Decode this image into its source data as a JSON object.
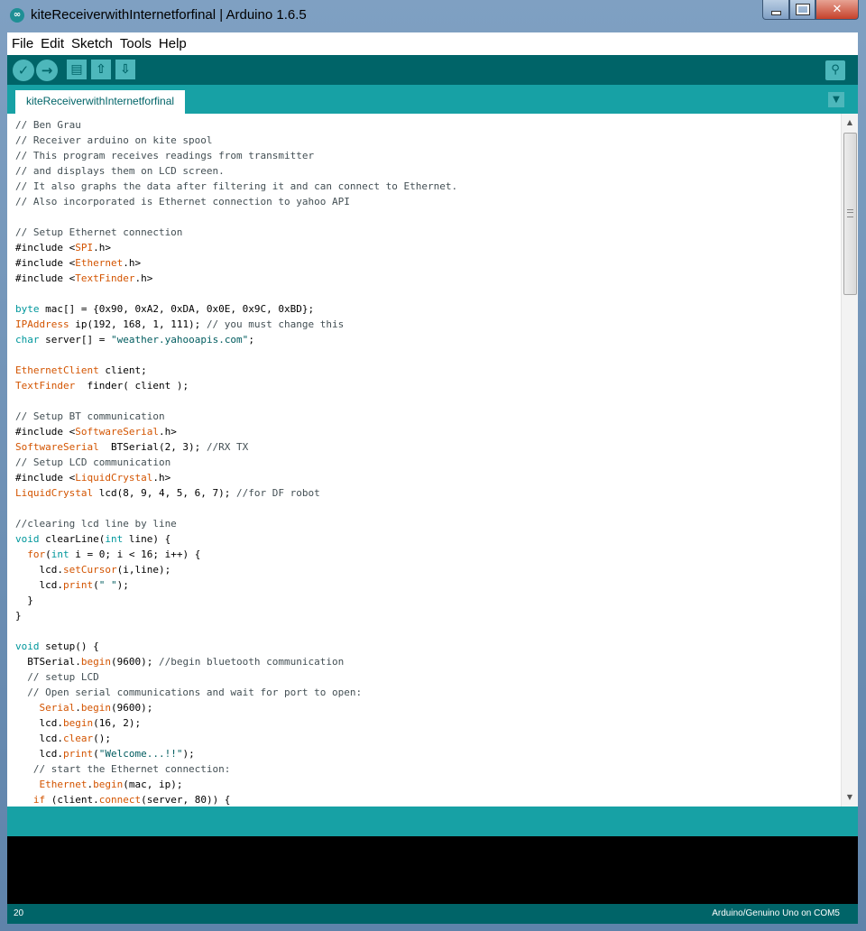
{
  "window": {
    "icon": "arduino-logo-icon",
    "title": "kiteReceiverwithInternetforfinal | Arduino 1.6.5",
    "buttons": {
      "minimize_icon": "minimize-icon",
      "maximize_icon": "maximize-icon",
      "close_icon": "close-icon",
      "close_glyph": "✕"
    }
  },
  "menu": [
    "File",
    "Edit",
    "Sketch",
    "Tools",
    "Help"
  ],
  "toolbar": {
    "verify_icon": "checkmark-icon",
    "upload_icon": "right-arrow-icon",
    "new_icon": "new-file-icon",
    "open_icon": "open-arrow-up-icon",
    "save_icon": "save-arrow-down-icon",
    "serial_monitor_icon": "magnifier-icon",
    "glyphs": {
      "verify": "✓",
      "upload": "→",
      "new": "▤",
      "open": "⇧",
      "save": "⇩",
      "serial": "⚲"
    }
  },
  "tabs": {
    "active": "kiteReceiverwithInternetforfinal",
    "menu_glyph": "▼"
  },
  "code_lines": [
    [
      [
        "c",
        "// Ben Grau"
      ]
    ],
    [
      [
        "c",
        "// Receiver arduino on kite spool"
      ]
    ],
    [
      [
        "c",
        "// This program receives readings from transmitter"
      ]
    ],
    [
      [
        "c",
        "// and displays them on LCD screen."
      ]
    ],
    [
      [
        "c",
        "// It also graphs the data after filtering it and can connect to Ethernet."
      ]
    ],
    [
      [
        "c",
        "// Also incorporated is Ethernet connection to yahoo API"
      ]
    ],
    [],
    [
      [
        "c",
        "// Setup Ethernet connection"
      ]
    ],
    [
      [
        "n",
        "#include <"
      ],
      [
        "t",
        "SPI"
      ],
      [
        "n",
        ".h>"
      ]
    ],
    [
      [
        "n",
        "#include <"
      ],
      [
        "t",
        "Ethernet"
      ],
      [
        "n",
        ".h>"
      ]
    ],
    [
      [
        "n",
        "#include <"
      ],
      [
        "t",
        "TextFinder"
      ],
      [
        "n",
        ".h>"
      ]
    ],
    [],
    [
      [
        "k",
        "byte"
      ],
      [
        "n",
        " mac[] = {0x90, 0xA2, 0xDA, 0x0E, 0x9C, 0xBD};"
      ]
    ],
    [
      [
        "t",
        "IPAddress"
      ],
      [
        "n",
        " ip(192, 168, 1, 111); "
      ],
      [
        "c",
        "// you must change this"
      ]
    ],
    [
      [
        "k",
        "char"
      ],
      [
        "n",
        " server[] = "
      ],
      [
        "s",
        "\"weather.yahooapis.com\""
      ],
      [
        "n",
        ";"
      ]
    ],
    [],
    [
      [
        "t",
        "EthernetClient"
      ],
      [
        "n",
        " client;"
      ]
    ],
    [
      [
        "t",
        "TextFinder"
      ],
      [
        "n",
        "  finder( client );"
      ]
    ],
    [],
    [
      [
        "c",
        "// Setup BT communication"
      ]
    ],
    [
      [
        "n",
        "#include <"
      ],
      [
        "t",
        "SoftwareSerial"
      ],
      [
        "n",
        ".h>"
      ]
    ],
    [
      [
        "t",
        "SoftwareSerial"
      ],
      [
        "n",
        "  BTSerial(2, 3); "
      ],
      [
        "c",
        "//RX TX"
      ]
    ],
    [
      [
        "c",
        "// Setup LCD communication"
      ]
    ],
    [
      [
        "n",
        "#include <"
      ],
      [
        "t",
        "LiquidCrystal"
      ],
      [
        "n",
        ".h>"
      ]
    ],
    [
      [
        "t",
        "LiquidCrystal"
      ],
      [
        "n",
        " lcd(8, 9, 4, 5, 6, 7); "
      ],
      [
        "c",
        "//for DF robot"
      ]
    ],
    [],
    [
      [
        "c",
        "//clearing lcd line by line"
      ]
    ],
    [
      [
        "k",
        "void"
      ],
      [
        "n",
        " clearLine("
      ],
      [
        "k",
        "int"
      ],
      [
        "n",
        " line) {"
      ]
    ],
    [
      [
        "n",
        "  "
      ],
      [
        "t",
        "for"
      ],
      [
        "n",
        "("
      ],
      [
        "k",
        "int"
      ],
      [
        "n",
        " i = 0; i < 16; i++) {"
      ]
    ],
    [
      [
        "n",
        "    lcd."
      ],
      [
        "t",
        "setCursor"
      ],
      [
        "n",
        "(i,line);"
      ]
    ],
    [
      [
        "n",
        "    lcd."
      ],
      [
        "t",
        "print"
      ],
      [
        "n",
        "("
      ],
      [
        "s",
        "\" \""
      ],
      [
        "n",
        ");"
      ]
    ],
    [
      [
        "n",
        "  }"
      ]
    ],
    [
      [
        "n",
        "}"
      ]
    ],
    [],
    [
      [
        "k",
        "void"
      ],
      [
        "n",
        " setup() {"
      ]
    ],
    [
      [
        "n",
        "  BTSerial."
      ],
      [
        "t",
        "begin"
      ],
      [
        "n",
        "(9600); "
      ],
      [
        "c",
        "//begin bluetooth communication"
      ]
    ],
    [
      [
        "n",
        "  "
      ],
      [
        "c",
        "// setup LCD"
      ]
    ],
    [
      [
        "n",
        "  "
      ],
      [
        "c",
        "// Open serial communications and wait for port to open:"
      ]
    ],
    [
      [
        "n",
        "    "
      ],
      [
        "t",
        "Serial"
      ],
      [
        "n",
        "."
      ],
      [
        "t",
        "begin"
      ],
      [
        "n",
        "(9600);"
      ]
    ],
    [
      [
        "n",
        "    lcd."
      ],
      [
        "t",
        "begin"
      ],
      [
        "n",
        "(16, 2);"
      ]
    ],
    [
      [
        "n",
        "    lcd."
      ],
      [
        "t",
        "clear"
      ],
      [
        "n",
        "();"
      ]
    ],
    [
      [
        "n",
        "    lcd."
      ],
      [
        "t",
        "print"
      ],
      [
        "n",
        "("
      ],
      [
        "s",
        "\"Welcome...!!\""
      ],
      [
        "n",
        ");"
      ]
    ],
    [
      [
        "n",
        "   "
      ],
      [
        "c",
        "// start the Ethernet connection:"
      ]
    ],
    [
      [
        "n",
        "    "
      ],
      [
        "t",
        "Ethernet"
      ],
      [
        "n",
        "."
      ],
      [
        "t",
        "begin"
      ],
      [
        "n",
        "(mac, ip);"
      ]
    ],
    [
      [
        "n",
        "   "
      ],
      [
        "t",
        "if"
      ],
      [
        "n",
        " (client."
      ],
      [
        "t",
        "connect"
      ],
      [
        "n",
        "(server, 80)) {"
      ]
    ]
  ],
  "scrollbar": {
    "up_icon": "scroll-up-arrow-icon",
    "down_icon": "scroll-down-arrow-icon",
    "up_glyph": "▲",
    "down_glyph": "▼"
  },
  "footer": {
    "line_number": "20",
    "board": "Arduino/Genuino Uno on COM5"
  },
  "colors": {
    "toolbar": "#006468",
    "tabbar": "#17a1a5",
    "comment": "#434f54",
    "keyword": "#00979c",
    "type": "#d35400",
    "string": "#005c5f",
    "console": "#000000"
  }
}
